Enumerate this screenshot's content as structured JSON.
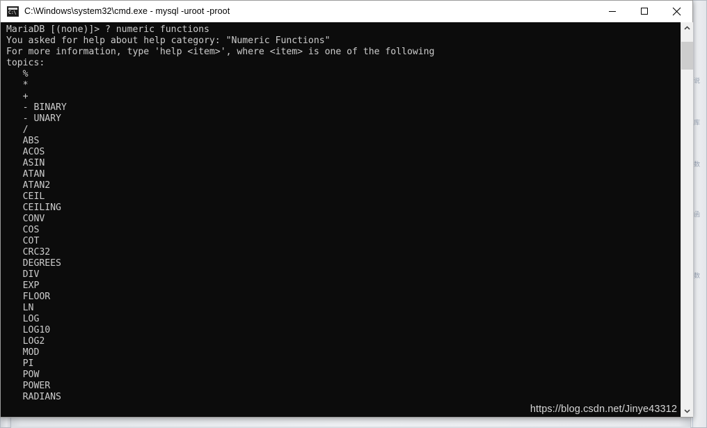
{
  "window": {
    "title": "C:\\Windows\\system32\\cmd.exe - mysql  -uroot -proot",
    "icon_name": "cmd-console-icon",
    "icon_text": "C:\\",
    "controls": {
      "minimize_label": "Minimize",
      "maximize_label": "Maximize",
      "close_label": "Close"
    },
    "colors": {
      "titlebar_background": "#ffffff",
      "titlebar_text": "#000000",
      "console_background": "#0c0c0c",
      "console_text": "#cccccc",
      "scrollbar_track": "#f0f0f0",
      "scrollbar_thumb": "#cdcdcd",
      "desktop_background": "#eef0f3"
    }
  },
  "console": {
    "prompt_line": "MariaDB [(none)]> ? numeric functions",
    "lines": [
      "MariaDB [(none)]> ? numeric functions",
      "You asked for help about help category: \"Numeric Functions\"",
      "For more information, type 'help <item>', where <item> is one of the following",
      "topics:",
      "   %",
      "   *",
      "   +",
      "   - BINARY",
      "   - UNARY",
      "   /",
      "   ABS",
      "   ACOS",
      "   ASIN",
      "   ATAN",
      "   ATAN2",
      "   CEIL",
      "   CEILING",
      "   CONV",
      "   COS",
      "   COT",
      "   CRC32",
      "   DEGREES",
      "   DIV",
      "   EXP",
      "   FLOOR",
      "   LN",
      "   LOG",
      "   LOG10",
      "   LOG2",
      "   MOD",
      "   PI",
      "   POW",
      "   POWER",
      "   RADIANS"
    ],
    "topics": [
      "%",
      "*",
      "+",
      "- BINARY",
      "- UNARY",
      "/",
      "ABS",
      "ACOS",
      "ASIN",
      "ATAN",
      "ATAN2",
      "CEIL",
      "CEILING",
      "CONV",
      "COS",
      "COT",
      "CRC32",
      "DEGREES",
      "DIV",
      "EXP",
      "FLOOR",
      "LN",
      "LOG",
      "LOG10",
      "LOG2",
      "MOD",
      "PI",
      "POW",
      "POWER",
      "RADIANS"
    ],
    "help_category": "Numeric Functions"
  },
  "scrollbar": {
    "up_arrow_name": "scroll-up-arrow",
    "down_arrow_name": "scroll-down-arrow"
  },
  "watermark": {
    "text": "https://blog.csdn.net/Jinye43312"
  },
  "background": {
    "smudges": [
      "说",
      "库",
      "数",
      "函",
      "数"
    ]
  }
}
